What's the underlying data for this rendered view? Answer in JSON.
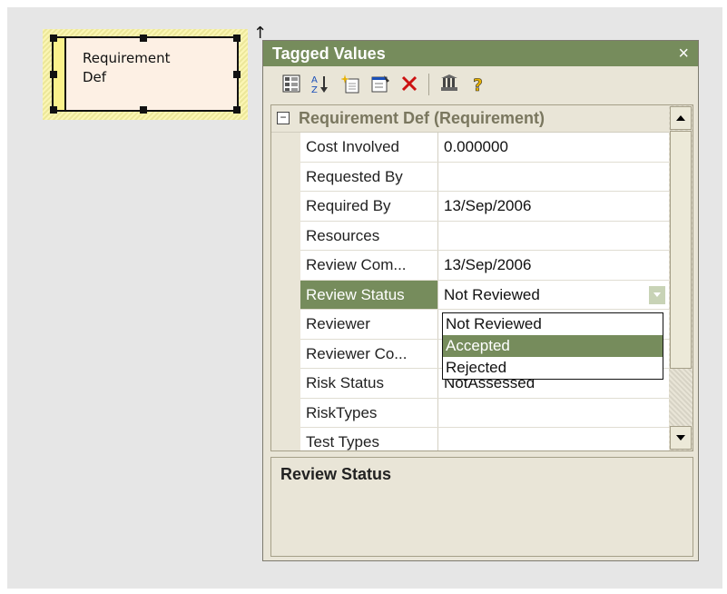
{
  "diagram": {
    "element": {
      "name_line1": "Requirement",
      "name_line2": "Def"
    },
    "link_arrow": "↑"
  },
  "window": {
    "title": "Tagged Values",
    "close": "×"
  },
  "toolbar": {
    "buttons": [
      "categorized-view-icon",
      "alphabetical-sort-icon",
      "new-tag-icon",
      "properties-icon",
      "delete-icon",
      "columns-icon",
      "help-icon"
    ]
  },
  "section": {
    "toggle": "−",
    "title": "Requirement Def (Requirement)"
  },
  "properties": [
    {
      "name": "Cost Involved",
      "value": "0.000000"
    },
    {
      "name": "Requested By",
      "value": ""
    },
    {
      "name": "Required By",
      "value": "13/Sep/2006"
    },
    {
      "name": "Resources",
      "value": ""
    },
    {
      "name": "Review Com...",
      "value": "13/Sep/2006"
    },
    {
      "name": "Review Status",
      "value": "Not Reviewed"
    },
    {
      "name": "Reviewer",
      "value": ""
    },
    {
      "name": "Reviewer Co...",
      "value": ""
    },
    {
      "name": "Risk Status",
      "value": "NotAssessed"
    },
    {
      "name": "RiskTypes",
      "value": ""
    },
    {
      "name": "Test Types",
      "value": ""
    }
  ],
  "dropdown": {
    "options": [
      "Not Reviewed",
      "Accepted",
      "Rejected"
    ],
    "highlighted": "Accepted"
  },
  "description": {
    "title": "Review Status"
  },
  "colors": {
    "title_bar": "#768c5c",
    "highlight": "#768c5c",
    "panel_bg": "#e9e5d7"
  }
}
